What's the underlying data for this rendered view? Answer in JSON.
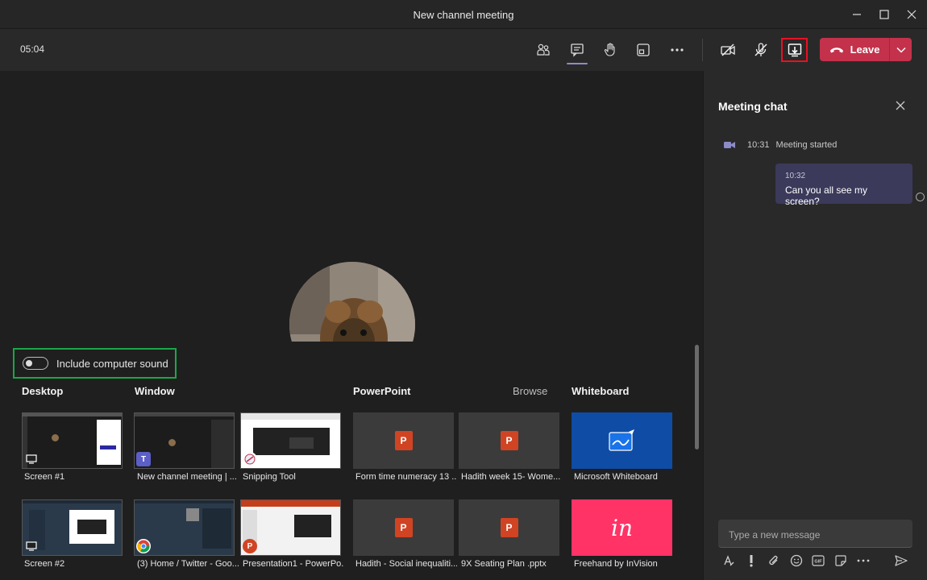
{
  "window": {
    "title": "New channel meeting",
    "minimize_icon": "minimize-icon",
    "maximize_icon": "maximize-icon",
    "close_icon": "close-icon"
  },
  "toolbar": {
    "timer": "05:04",
    "leave_label": "Leave",
    "buttons": [
      "participants-icon",
      "chat-icon",
      "raise-hand-icon",
      "rooms-icon",
      "more-icon",
      "camera-off-icon",
      "mic-off-icon",
      "share-tray-icon",
      "chevron-down-icon"
    ],
    "leave_color": "#c4314b"
  },
  "share_tray": {
    "include_sound_label": "Include computer sound",
    "include_sound_on": false,
    "sections": {
      "desktop": "Desktop",
      "window": "Window",
      "powerpoint": "PowerPoint",
      "browse": "Browse",
      "whiteboard": "Whiteboard"
    },
    "desktop": [
      {
        "caption": "Screen #1"
      },
      {
        "caption": "Screen #2"
      }
    ],
    "windows": [
      {
        "caption": "New channel meeting | ..."
      },
      {
        "caption": "Snipping Tool"
      },
      {
        "caption": "(3) Home / Twitter - Goo..."
      },
      {
        "caption": "Presentation1 - PowerPo..."
      }
    ],
    "powerpoint": [
      {
        "caption": "Form time numeracy 13 ..."
      },
      {
        "caption": "Hadith week 15- Wome..."
      },
      {
        "caption": "Hadith - Social inequaliti..."
      },
      {
        "caption": "9X Seating Plan .pptx"
      }
    ],
    "whiteboard": [
      {
        "caption": "Microsoft Whiteboard"
      },
      {
        "caption": "Freehand by InVision",
        "logo": "in"
      }
    ]
  },
  "chat": {
    "title": "Meeting chat",
    "system_time": "10:31",
    "system_text": "Meeting started",
    "message_time": "10:32",
    "message_text": "Can you all see my screen?",
    "input_placeholder": "Type a new message",
    "composer_icons": [
      "format-icon",
      "important-icon",
      "attach-icon",
      "emoji-icon",
      "gif-icon",
      "sticker-icon",
      "more-icon",
      "send-icon"
    ]
  },
  "colors": {
    "accent": "#6264a7",
    "highlight_red": "#e81123",
    "highlight_green": "#1aa74a",
    "whiteboard_blue": "#0f4ca6",
    "invision_pink": "#ff3366"
  }
}
